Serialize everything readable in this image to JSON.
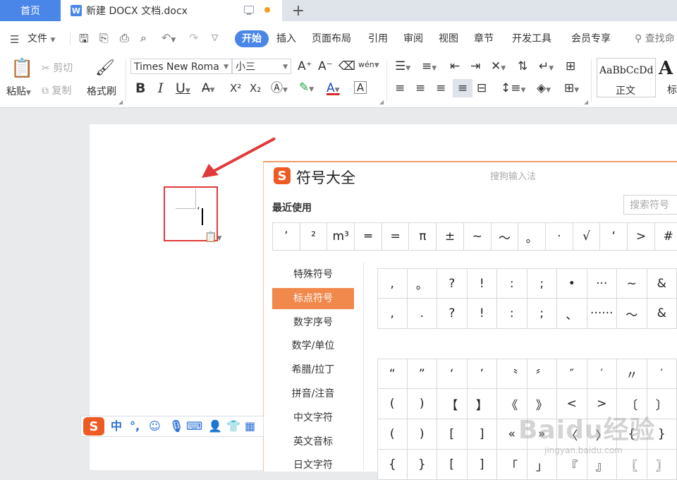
{
  "tabs": {
    "home": "首页",
    "doc_title": "新建 DOCX 文档.docx",
    "new_tab": "+"
  },
  "menu": {
    "file": "文件",
    "items": [
      "开始",
      "插入",
      "页面布局",
      "引用",
      "审阅",
      "视图",
      "章节",
      "开发工具",
      "会员专享"
    ],
    "find": "查找命"
  },
  "ribbon": {
    "paste": "粘贴",
    "cut": "剪切",
    "copy": "复制",
    "format_painter": "格式刷",
    "font_name": "Times New Roma",
    "font_size": "小三",
    "pinyin": "wén",
    "bold": "B",
    "italic": "I",
    "underline": "U",
    "superscript": "X²",
    "subscript": "X₂",
    "style_preview": "AaBbCcDd",
    "style_name": "正文",
    "next_style_preview": "A",
    "next_style_name": "标"
  },
  "document": {
    "typed_char": "’"
  },
  "symbol_panel": {
    "title": "符号大全",
    "brand": "搜狗输入法",
    "recent_label": "最近使用",
    "search_placeholder": "搜索符号",
    "recent": [
      "’",
      "²",
      "m³",
      "═",
      "=",
      "π",
      "±",
      "~",
      "～",
      "。",
      "·",
      "√",
      "‘",
      ">",
      "#"
    ],
    "categories": [
      "特殊符号",
      "标点符号",
      "数字序号",
      "数学/单位",
      "希腊/拉丁",
      "拼音/注音",
      "中文字符",
      "英文音标",
      "日文字符"
    ],
    "active_category": "标点符号",
    "grid_a": [
      [
        ",",
        "。",
        "?",
        "!",
        ":",
        ";",
        "•",
        "···",
        "~",
        "&"
      ],
      [
        ",",
        ".",
        "?",
        "!",
        ":",
        ";",
        "、",
        "······",
        "～",
        "&"
      ]
    ],
    "grid_b": [
      [
        "“",
        "”",
        "‘",
        "’",
        "〝",
        "〞",
        "″",
        "′",
        "〃",
        "′"
      ],
      [
        "(",
        ")",
        "【",
        "】",
        "《",
        "》",
        "<",
        ">",
        "〔",
        "〕"
      ],
      [
        "(",
        ")",
        "[",
        "]",
        "«",
        "»",
        "〈",
        "〉",
        "{",
        "}"
      ],
      [
        "{",
        "}",
        "[",
        "]",
        "「",
        "」",
        "『",
        "』",
        "〖",
        "〗"
      ]
    ]
  },
  "ime": {
    "logo": "S",
    "mode": "中",
    "punct": "°,"
  },
  "watermark": {
    "main": "Baidu经验",
    "sub": "jingyan.baidu.com"
  },
  "colors": {
    "accent": "#4a86e8",
    "sogou": "#ee5a24",
    "active_category": "#f2894c",
    "annotation": "#e03a3a"
  }
}
